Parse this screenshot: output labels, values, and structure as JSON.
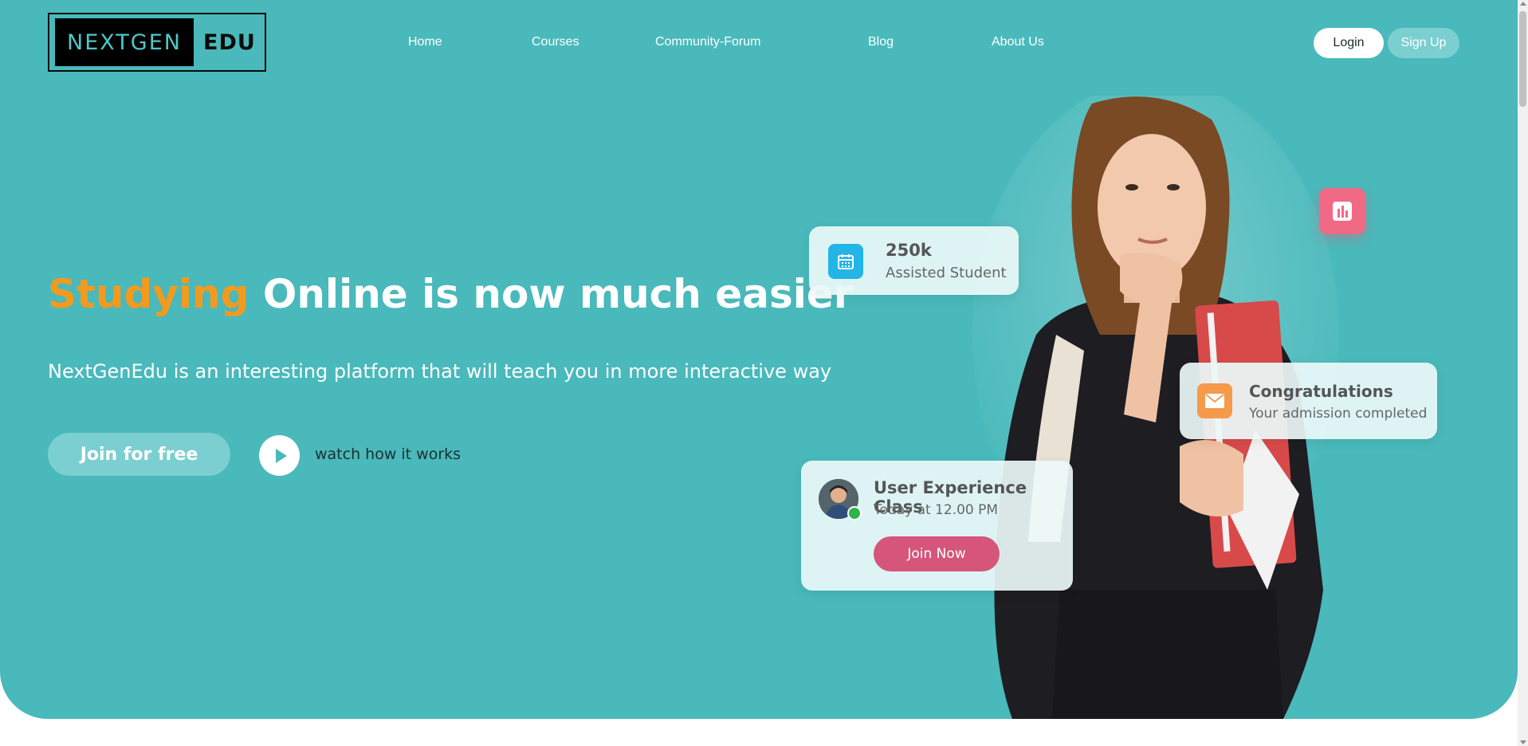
{
  "brand": {
    "logo_part1": "NEXTGEN",
    "logo_part2": "EDU"
  },
  "nav": {
    "items": [
      "Home",
      "Courses",
      "Community-Forum",
      "Blog",
      "About Us"
    ]
  },
  "auth": {
    "login": "Login",
    "signup": "Sign Up"
  },
  "hero": {
    "headline_highlight": "Studying",
    "headline_rest": " Online is now much easier",
    "subline": "NextGenEdu is an interesting platform that will teach you in more interactive way",
    "join_button": "Join for free",
    "watch_label": "watch how it works"
  },
  "cards": {
    "students": {
      "count": "250k",
      "label": "Assisted Student",
      "icon": "calendar-icon"
    },
    "congrats": {
      "title": "Congratulations",
      "subtitle": "Your admission completed",
      "icon": "mail-icon"
    },
    "class": {
      "title": "User Experience Class",
      "time": "Today at 12.00 PM",
      "button": "Join Now"
    },
    "stats_icon": "bar-chart-icon"
  },
  "colors": {
    "hero_bg": "#49b9bb",
    "accent": "#f39a1e",
    "pink": "#d5567a"
  }
}
